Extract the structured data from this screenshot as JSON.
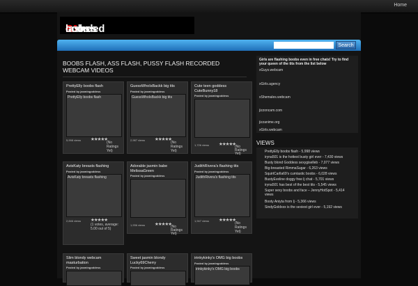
{
  "topbar": {
    "home": "Home"
  },
  "logo": {
    "r1": "R",
    "w1": "ecorded ",
    "r2": "LJ ",
    "r3": "B",
    "w2": "oobs ",
    "r4": "F",
    "w3": "lashes"
  },
  "search": {
    "button": "Search",
    "placeholder": ""
  },
  "page": {
    "title": "BOOBS FLASH, ASS FLASH, PUSSY FLASH RECORDED WEBCAM VIDEOS"
  },
  "cards": [
    {
      "title": "PrettyElly boobs flash",
      "posted": "Posted by jasmingoddess",
      "thumb": "PrettyElly boobs flash",
      "views": "5,998 views",
      "stars": "★★★★★",
      "rating": "(No Ratings Yet)"
    },
    {
      "title": "GuessWhoIsBackk big tits",
      "posted": "Posted by jasmingoddess",
      "thumb": "GuessWhoIsBackk big tits",
      "views": "2,987 views",
      "stars": "★★★★★",
      "rating": "(No Ratings Yet)"
    },
    {
      "title": "Cute teen goddess CuteBunny18",
      "posted": "Posted by jasmingoddess",
      "thumb": "",
      "views": "1,726 views",
      "stars": "★★★★★",
      "rating": "(No Ratings Yet)"
    },
    {
      "title": "AvisKaty breasts flashing",
      "posted": "Posted by jasmingoddess",
      "thumb": "AvisKaty breasts flashing",
      "views": "2,846 views",
      "stars": "★★★★★",
      "rating": "(1 votes, average: 5.00 out of 5)"
    },
    {
      "title": "Adorable jasmin babe MelissaGreen",
      "posted": "Posted by jasmingoddess",
      "thumb": "",
      "views": "1,936 views",
      "stars": "★★★★★",
      "rating": "(No Ratings Yet)"
    },
    {
      "title": "JudithRivera's flashing tits",
      "posted": "Posted by jasmingoddess",
      "thumb": "JudithRivera's flashing tits",
      "views": "1,947 views",
      "stars": "★★★★★",
      "rating": "(No Ratings Yet)"
    },
    {
      "title": "Slim blondy webcam masturbation",
      "posted": "Posted by jasmingoddess",
      "thumb": ""
    },
    {
      "title": "Sweet jasmin blondy Lucky69Cherry",
      "posted": "Posted by jasmingoddess",
      "thumb": ""
    },
    {
      "title": "irinkykinky's OMG big boobs",
      "posted": "Posted by jasmingoddess",
      "thumb": "irinkykinky's OMG big boobs"
    }
  ],
  "sidebar": {
    "intro": "Girls are flashing boobs even in free chats! Try to find your queen of the tits from the list below",
    "links": [
      "xGuys.webcam",
      "xGirls.agency",
      "xShemales.webcam",
      "jizzoncam.com",
      "jizzanime.org",
      "xGirls.webcam"
    ],
    "views_title": "VIEWS",
    "views": [
      "PrettyElly boobs flash - 5,998 views",
      "iryna501 is the hottest busty girl ever - 7,430 views",
      "Busty blond Goddess sexygiselleb - 7,077 views",
      "Big-breasted RimmaSugar - 6,263 views",
      "SquirtCarlla69's cumtastic boobs - 6,028 views",
      "BustyEveline doggy free lj chat - 5,701 views",
      "iryna501 has best of the best tits - 5,545 views",
      "Super sexy boobs and face – JennyHotSpot - 5,414 views",
      "Booty Aniyta from lj - 5,366 views",
      "SindyGoldxxx is the sexiest girl ever - 5,192 views"
    ]
  }
}
